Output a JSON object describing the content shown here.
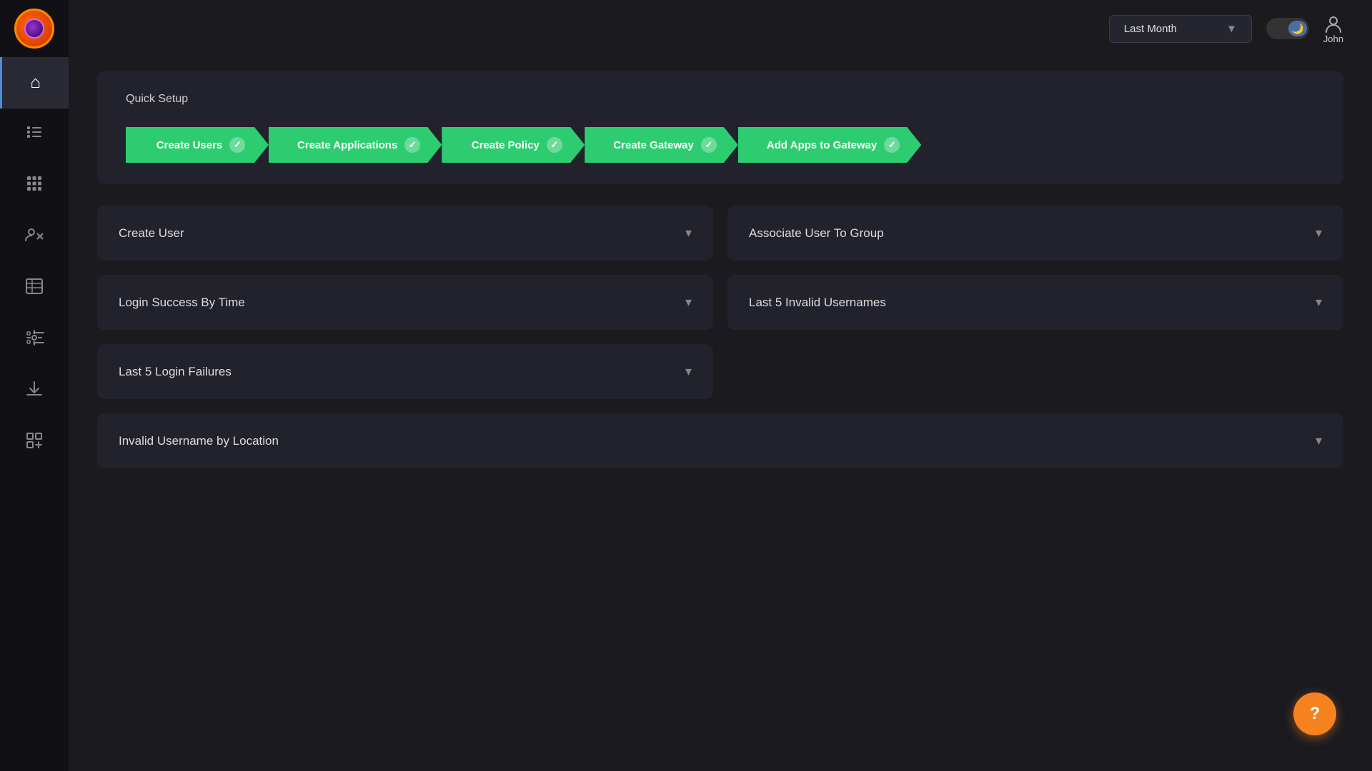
{
  "app": {
    "logo_alt": "App Logo"
  },
  "topbar": {
    "filter_label": "Last Month",
    "user_name": "John",
    "theme_icon": "🌙"
  },
  "sidebar": {
    "items": [
      {
        "id": "home",
        "icon": "⌂",
        "active": true
      },
      {
        "id": "list",
        "icon": "☰"
      },
      {
        "id": "grid",
        "icon": "⊞"
      },
      {
        "id": "users-x",
        "icon": "✖"
      },
      {
        "id": "table",
        "icon": "⊟"
      },
      {
        "id": "settings-list",
        "icon": "⚙"
      },
      {
        "id": "download",
        "icon": "↓"
      },
      {
        "id": "add-grid",
        "icon": "⊞"
      }
    ]
  },
  "quick_setup": {
    "title": "Quick Setup",
    "steps": [
      {
        "id": "create-users",
        "label": "Create Users",
        "done": true
      },
      {
        "id": "create-applications",
        "label": "Create Applications",
        "done": true
      },
      {
        "id": "create-policy",
        "label": "Create Policy",
        "done": true
      },
      {
        "id": "create-gateway",
        "label": "Create Gateway",
        "done": true
      },
      {
        "id": "add-apps-to-gateway",
        "label": "Add Apps to Gateway",
        "done": true
      }
    ]
  },
  "panels": {
    "left_top": {
      "title": "Create User",
      "chevron": "▾"
    },
    "right_top": {
      "title": "Associate User To Group",
      "chevron": "▾"
    },
    "left_middle": {
      "title": "Login Success By Time",
      "chevron": "▾"
    },
    "right_middle": {
      "title": "Last 5 Invalid Usernames",
      "chevron": "▾"
    },
    "left_bottom": {
      "title": "Last 5 Login Failures",
      "chevron": "▾"
    },
    "full_bottom": {
      "title": "Invalid Username by Location",
      "chevron": "▾"
    }
  },
  "fab": {
    "icon": "?"
  }
}
